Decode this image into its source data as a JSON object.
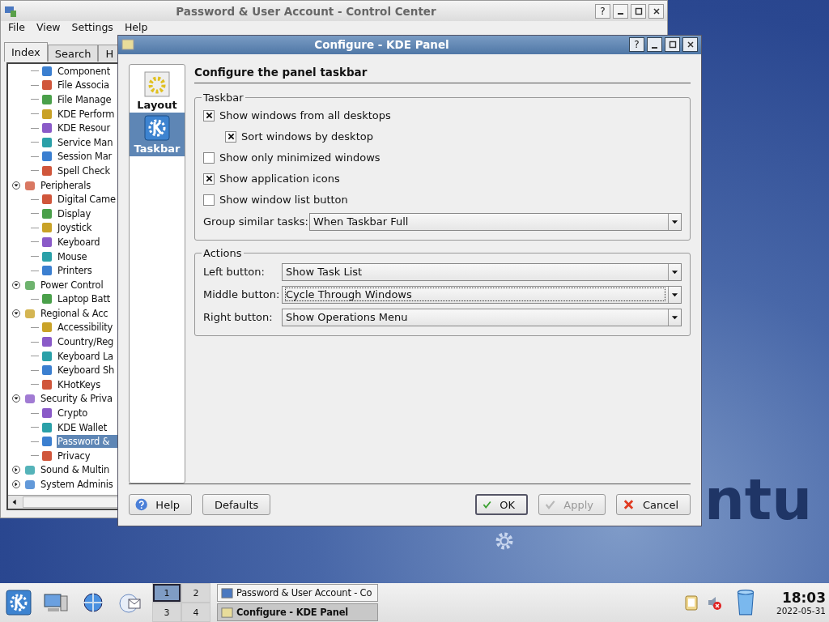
{
  "wallpaper": {
    "logo": "ntu"
  },
  "control_center": {
    "title": "Password & User Account - Control Center",
    "help": "?",
    "menu": [
      "File",
      "View",
      "Settings",
      "Help"
    ],
    "tabs": [
      {
        "label": "Index",
        "selected": true
      },
      {
        "label": "Search",
        "selected": false
      },
      {
        "label": "H",
        "selected": false
      }
    ],
    "tree": [
      {
        "children": [
          {
            "label": "Component",
            "selected": false
          },
          {
            "label": "File Associa",
            "selected": false
          },
          {
            "label": "File Manage",
            "selected": false
          },
          {
            "label": "KDE Perform",
            "selected": false
          },
          {
            "label": "KDE Resour",
            "selected": false
          },
          {
            "label": "Service Man",
            "selected": false
          },
          {
            "label": "Session Mar",
            "selected": false
          },
          {
            "label": "Spell Check",
            "selected": false
          }
        ]
      },
      {
        "label": "Peripherals",
        "expanded": true,
        "children": [
          {
            "label": "Digital Came",
            "selected": false
          },
          {
            "label": "Display",
            "selected": false
          },
          {
            "label": "Joystick",
            "selected": false
          },
          {
            "label": "Keyboard",
            "selected": false
          },
          {
            "label": "Mouse",
            "selected": false
          },
          {
            "label": "Printers",
            "selected": false
          }
        ]
      },
      {
        "label": "Power Control",
        "expanded": true,
        "children": [
          {
            "label": "Laptop Batt",
            "selected": false
          }
        ]
      },
      {
        "label": "Regional & Acc",
        "expanded": true,
        "children": [
          {
            "label": "Accessibility",
            "selected": false
          },
          {
            "label": "Country/Reg",
            "selected": false
          },
          {
            "label": "Keyboard La",
            "selected": false
          },
          {
            "label": "Keyboard Sh",
            "selected": false
          },
          {
            "label": "KHotKeys",
            "selected": false
          }
        ]
      },
      {
        "label": "Security & Priva",
        "expanded": true,
        "children": [
          {
            "label": "Crypto",
            "selected": false
          },
          {
            "label": "KDE Wallet",
            "selected": false
          },
          {
            "label": "Password &",
            "selected": true
          },
          {
            "label": "Privacy",
            "selected": false
          }
        ]
      },
      {
        "label": "Sound & Multin",
        "expanded": false
      },
      {
        "label": "System Adminis",
        "expanded": false
      }
    ]
  },
  "dialog": {
    "title": "Configure - KDE Panel",
    "help": "?",
    "pages": [
      {
        "label": "Layout",
        "selected": false
      },
      {
        "label": "Taskbar",
        "selected": true
      }
    ],
    "heading": "Configure the panel taskbar",
    "taskbar_group": {
      "title": "Taskbar",
      "options": [
        {
          "label": "Show windows from all desktops",
          "checked": true,
          "children": [
            {
              "label": "Sort windows by desktop",
              "checked": true
            }
          ]
        },
        {
          "label": "Show only minimized windows",
          "checked": false
        },
        {
          "label": "Show application icons",
          "checked": true
        },
        {
          "label": "Show window list button",
          "checked": false
        }
      ],
      "group_label": "Group similar tasks:",
      "group_value": "When Taskbar Full"
    },
    "actions_group": {
      "title": "Actions",
      "rows": [
        {
          "label": "Left button:",
          "value": "Show Task List",
          "focused": false
        },
        {
          "label": "Middle button:",
          "value": "Cycle Through Windows",
          "focused": true
        },
        {
          "label": "Right button:",
          "value": "Show Operations Menu",
          "focused": false
        }
      ]
    },
    "buttons": [
      {
        "label": "Help",
        "kind": "help",
        "disabled": false
      },
      {
        "label": "Defaults",
        "kind": "plain",
        "disabled": false
      },
      {
        "label": "OK",
        "kind": "ok",
        "disabled": false
      },
      {
        "label": "Apply",
        "kind": "apply",
        "disabled": true
      },
      {
        "label": "Cancel",
        "kind": "cancel",
        "disabled": false
      }
    ]
  },
  "panel": {
    "pager": [
      {
        "label": "1",
        "selected": true
      },
      {
        "label": "2",
        "selected": false
      },
      {
        "label": "3",
        "selected": false
      },
      {
        "label": "4",
        "selected": false
      }
    ],
    "tasks": [
      {
        "label": "Password & User Account - Co",
        "active": false
      },
      {
        "label": "Configure - KDE Panel",
        "active": true
      }
    ],
    "time": "18:03",
    "date": "2022-05-31"
  }
}
